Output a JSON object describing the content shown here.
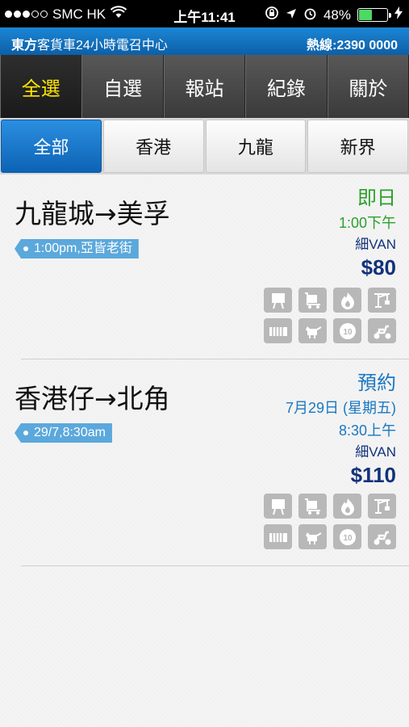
{
  "status_bar": {
    "carrier": "SMC HK",
    "time": "上午11:41",
    "battery_percent": "48%",
    "battery_level": 0.48
  },
  "header": {
    "title_bold": "東方",
    "title_rest": "客貨車24小時電召中心",
    "hotline": "熱線:2390 0000"
  },
  "main_tabs": [
    {
      "label": "全選",
      "active": true
    },
    {
      "label": "自選",
      "active": false
    },
    {
      "label": "報站",
      "active": false
    },
    {
      "label": "紀錄",
      "active": false
    },
    {
      "label": "關於",
      "active": false
    }
  ],
  "region_tabs": [
    {
      "label": "全部",
      "active": true
    },
    {
      "label": "香港",
      "active": false
    },
    {
      "label": "九龍",
      "active": false
    },
    {
      "label": "新界",
      "active": false
    }
  ],
  "orders": [
    {
      "route": "九龍城→美孚",
      "tag": "1:00pm,亞皆老街",
      "type": "即日",
      "date": "",
      "time": "1:00下午",
      "vehicle": "細VAN",
      "price": "$80",
      "color": "#2ca02c"
    },
    {
      "route": "香港仔→北角",
      "tag": "29/7,8:30am",
      "type": "預約",
      "date": "7月29日 (星期五)",
      "time": "8:30上午",
      "vehicle": "細VAN",
      "price": "$110",
      "color": "#1a78c2"
    }
  ],
  "service_icons": [
    "board-icon",
    "cart-icon",
    "fire-icon",
    "crane-icon",
    "truck-bed-icon",
    "pet-icon",
    "number-ten-icon",
    "scooter-icon"
  ],
  "service_icon_ten_label": "10",
  "colors": {
    "header_blue": "#0c5fa8",
    "active_tab_text": "#ffe600",
    "green": "#2ca02c",
    "blue": "#1a78c2",
    "price_navy": "#12327a",
    "tag_blue": "#5ba8dc"
  }
}
